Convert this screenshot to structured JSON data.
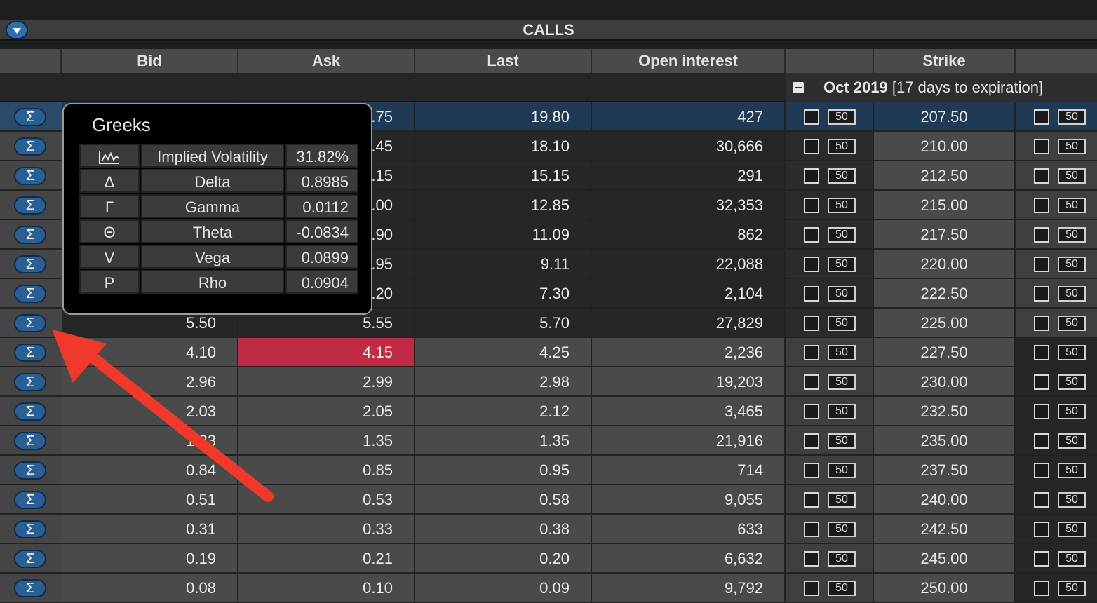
{
  "header": {
    "title": "CALLS",
    "columns": {
      "bid": "Bid",
      "ask": "Ask",
      "last": "Last",
      "open_interest": "Open interest",
      "blank": "",
      "strike": "Strike"
    }
  },
  "expiration": {
    "month": "Oct 2019",
    "days": "[17 days to expiration]"
  },
  "sigma_label": "Σ",
  "quantity_default": "50",
  "rows": [
    {
      "bid": "",
      "ask": "",
      "last": "19.80",
      "oi": "427",
      "strike": "207.50"
    },
    {
      "bid": "",
      "ask": "",
      "last": "18.10",
      "oi": "30,666",
      "strike": "210.00"
    },
    {
      "bid": "",
      "ask": "",
      "last": "15.15",
      "oi": "291",
      "strike": "212.50"
    },
    {
      "bid": "",
      "ask": "",
      "last": "12.85",
      "oi": "32,353",
      "strike": "215.00"
    },
    {
      "bid": "",
      "ask": "",
      "last": "11.09",
      "oi": "862",
      "strike": "217.50"
    },
    {
      "bid": "",
      "ask": "",
      "last": "9.11",
      "oi": "22,088",
      "strike": "220.00"
    },
    {
      "bid": "",
      "ask": "",
      "last": "7.30",
      "oi": "2,104",
      "strike": "222.50"
    },
    {
      "bid": "5.50",
      "ask": "5.55",
      "last": "5.70",
      "oi": "27,829",
      "strike": "225.00"
    },
    {
      "bid": "4.10",
      "ask": "4.15",
      "last": "4.25",
      "oi": "2,236",
      "strike": "227.50"
    },
    {
      "bid": "2.96",
      "ask": "2.99",
      "last": "2.98",
      "oi": "19,203",
      "strike": "230.00"
    },
    {
      "bid": "2.03",
      "ask": "2.05",
      "last": "2.12",
      "oi": "3,465",
      "strike": "232.50"
    },
    {
      "bid": "",
      "ask": "1.35",
      "last": "1.35",
      "oi": "21,916",
      "strike": "235.00"
    },
    {
      "bid": "0.84",
      "ask": "0.85",
      "last": "0.95",
      "oi": "714",
      "strike": "237.50"
    },
    {
      "bid": "0.51",
      "ask": "0.53",
      "last": "0.58",
      "oi": "9,055",
      "strike": "240.00"
    },
    {
      "bid": "0.31",
      "ask": "0.33",
      "last": "0.38",
      "oi": "633",
      "strike": "242.50"
    },
    {
      "bid": "0.19",
      "ask": "0.21",
      "last": "0.20",
      "oi": "6,632",
      "strike": "245.00"
    },
    {
      "bid": "0.08",
      "ask": "0.10",
      "last": "0.09",
      "oi": "9,792",
      "strike": "250.00"
    }
  ],
  "partial_ask_fragments": [
    ".75",
    ".45",
    ".15",
    ".00",
    ".90",
    ".95",
    ".20"
  ],
  "partial_bid_fragment": "1.33",
  "greeks_popup": {
    "title": "Greeks",
    "items": [
      {
        "symbol": "",
        "icon": "chart-icon",
        "name": "Implied Volatility",
        "value": "31.82%"
      },
      {
        "symbol": "Δ",
        "name": "Delta",
        "value": "0.8985"
      },
      {
        "symbol": "Γ",
        "name": "Gamma",
        "value": "0.0112"
      },
      {
        "symbol": "Θ",
        "name": "Theta",
        "value": "-0.0834"
      },
      {
        "symbol": "V",
        "name": "Vega",
        "value": "0.0899"
      },
      {
        "symbol": "P",
        "name": "Rho",
        "value": "0.0904"
      }
    ]
  },
  "colors": {
    "highlight_row": "#1e3b57",
    "ask_highlight": "#c02a43",
    "arrow": "#f0382b",
    "sigma_button": "#2a5f93"
  }
}
